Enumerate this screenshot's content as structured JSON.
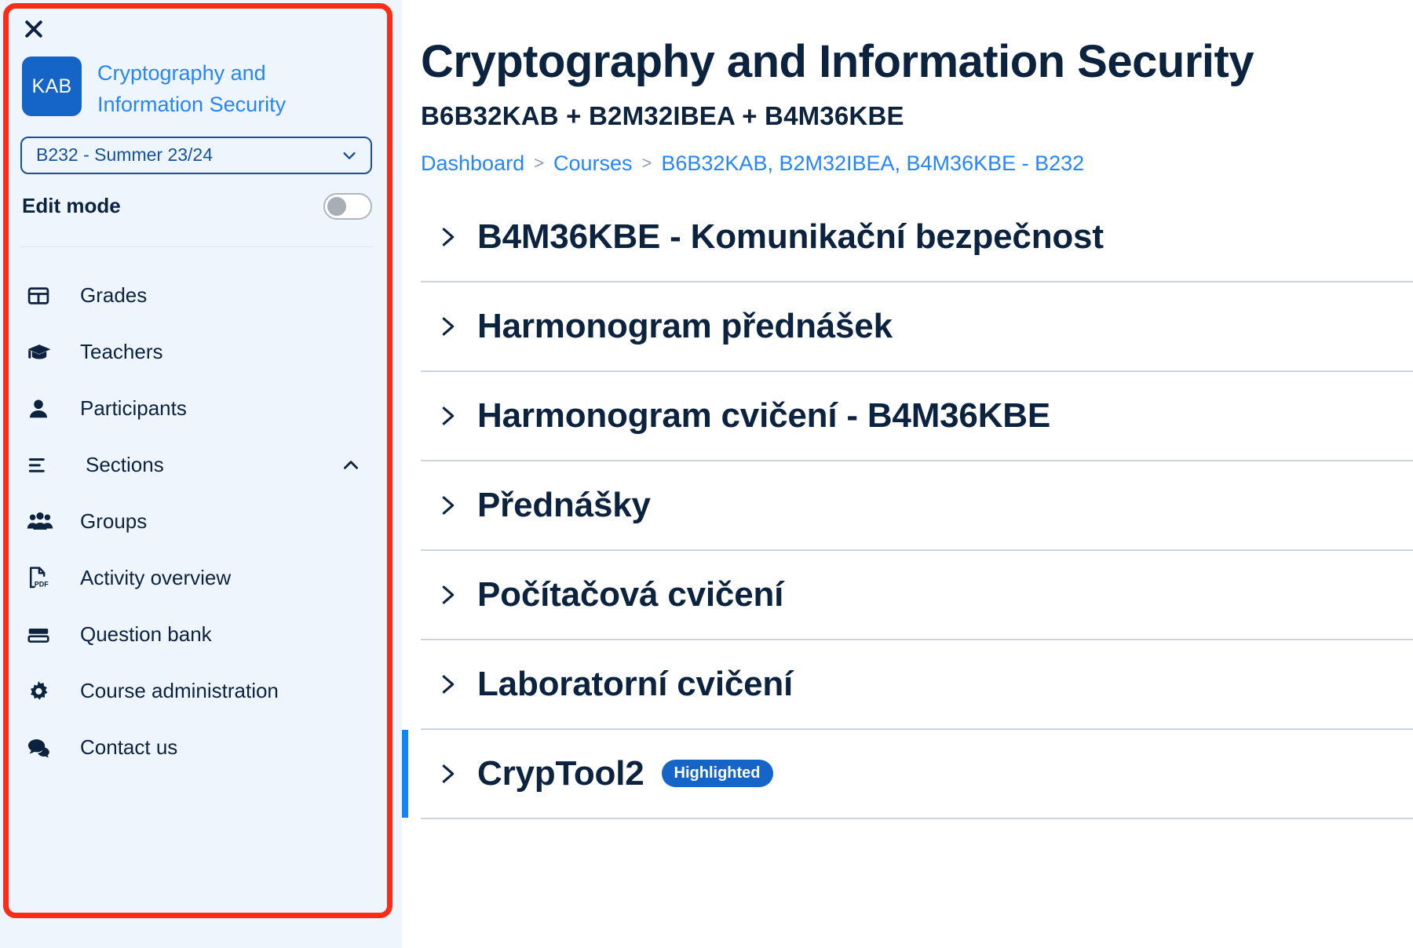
{
  "sidebar": {
    "close_icon": "close-icon",
    "brand": {
      "logo_text": "KAB",
      "logo_color": "#1565c9",
      "title": "Cryptography and Information Security",
      "title_color": "#2685fa"
    },
    "course_select": {
      "value": "B232 - Summer 23/24",
      "chevron": "chevron-down-icon"
    },
    "edit_mode": {
      "label": "Edit mode",
      "state": "off"
    },
    "items": [
      {
        "label": "Grades",
        "icon": "table-icon",
        "indented": false,
        "expander": null
      },
      {
        "label": "Teachers",
        "icon": "graduation-cap-icon",
        "indented": false,
        "expander": null
      },
      {
        "label": "Participants",
        "icon": "user-icon",
        "indented": false,
        "expander": null
      },
      {
        "label": "Sections",
        "icon": "list-icon",
        "indented": true,
        "expander": "chevron-up-icon"
      },
      {
        "label": "Groups",
        "icon": "users-icon",
        "indented": false,
        "expander": null
      },
      {
        "label": "Activity overview",
        "icon": "pdf-file-icon",
        "indented": false,
        "expander": null
      },
      {
        "label": "Question bank",
        "icon": "question-bank-icon",
        "indented": false,
        "expander": null
      },
      {
        "label": "Course administration",
        "icon": "gear-icon",
        "indented": false,
        "expander": null
      },
      {
        "label": "Contact us",
        "icon": "chat-bubbles-icon",
        "indented": false,
        "expander": null
      }
    ],
    "focus_ring_color": "#fa2e18",
    "background_color": "#eff5fd"
  },
  "main": {
    "title": "Cryptography and Information Security",
    "subtitle": "B6B32KAB + B2M32IBEA + B4M36KBE",
    "breadcrumb": [
      {
        "label": "Dashboard"
      },
      {
        "label": "Courses"
      },
      {
        "label": "B6B32KAB, B2M32IBEA, B4M36KBE - B232"
      }
    ],
    "breadcrumb_separator": ">",
    "sections": [
      {
        "title": "B4M36KBE - Komunikační bezpečnost",
        "badge": null,
        "highlighted": false
      },
      {
        "title": "Harmonogram přednášek",
        "badge": null,
        "highlighted": false
      },
      {
        "title": "Harmonogram cvičení - B4M36KBE",
        "badge": null,
        "highlighted": false
      },
      {
        "title": "Přednášky",
        "badge": null,
        "highlighted": false
      },
      {
        "title": "Počítačová cvičení",
        "badge": null,
        "highlighted": false
      },
      {
        "title": "Laboratorní cvičení",
        "badge": null,
        "highlighted": false
      },
      {
        "title": "CrypTool2",
        "badge": "Highlighted",
        "highlighted": true
      }
    ],
    "accent_color": "#1683f5",
    "badge_color": "#1565c9",
    "link_color": "#2685fa",
    "text_color": "#0c2340"
  }
}
